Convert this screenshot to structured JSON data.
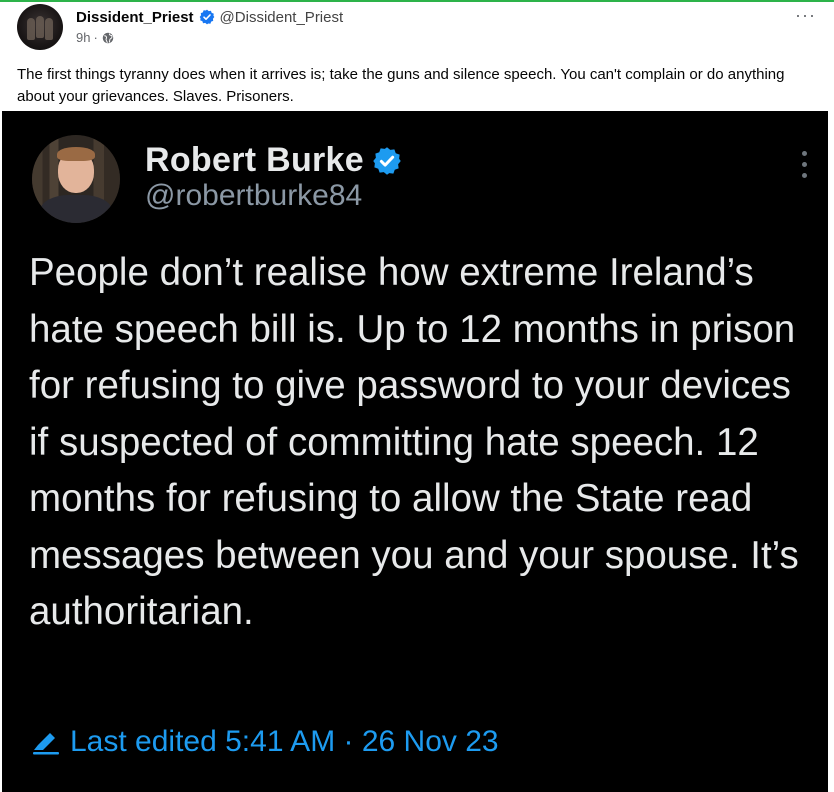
{
  "post": {
    "author_name": "Dissident_Priest",
    "author_handle": "@Dissident_Priest",
    "time": "9h",
    "separator": "·",
    "visibility_icon": "globe-icon",
    "more_icon": "more-horizontal-icon",
    "more_label": "···",
    "text": "The first things tyranny does when it arrives is; take the guns and silence speech. You can't complain or do anything about your grievances. Slaves. Prisoners."
  },
  "embedded_tweet": {
    "name": "Robert Burke",
    "handle": "@robertburke84",
    "verified_icon": "verified-badge-icon",
    "more_icon": "more-vertical-icon",
    "body": "People don’t realise how extreme Ireland’s hate speech bill is. Up to 12 months in prison for refusing to give password to your devices if suspected of committing hate speech. 12 months for refusing to allow the State read messages between you and your spouse. It’s authoritarian.",
    "edited_label": "Last edited 5:41 AM · 26 Nov 23",
    "edit_icon": "pencil-icon"
  },
  "colors": {
    "accent_line": "#2db34a",
    "verified_blue": "#1877f2",
    "tweet_background": "#000000",
    "tweet_text": "#e7e9ea",
    "tweet_secondary": "#8b98a5",
    "tweet_link_blue": "#1d9bf0"
  }
}
